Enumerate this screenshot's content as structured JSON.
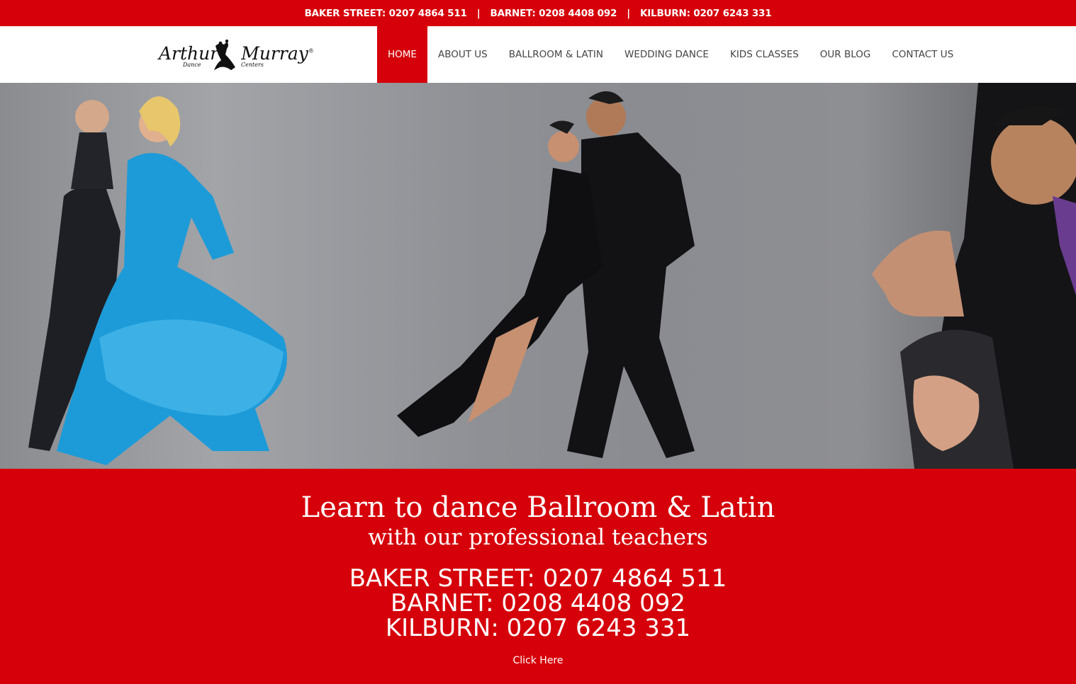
{
  "topbar": {
    "baker": "BAKER STREET: 0207 4864 511",
    "barnet": "BARNET: 0208 4408 092",
    "kilburn": "KILBURN: 0207 6243 331",
    "separator": "|"
  },
  "logo": {
    "left_word": "Arthur",
    "right_word": "Murray",
    "reg_mark": "®",
    "sub_left": "Dance",
    "sub_right": "Centers"
  },
  "nav": {
    "items": [
      {
        "label": "HOME",
        "active": true
      },
      {
        "label": "ABOUT US",
        "active": false
      },
      {
        "label": "BALLROOM & LATIN",
        "active": false
      },
      {
        "label": "WEDDING DANCE",
        "active": false
      },
      {
        "label": "KIDS CLASSES",
        "active": false
      },
      {
        "label": "OUR BLOG",
        "active": false
      },
      {
        "label": "CONTACT US",
        "active": false
      }
    ]
  },
  "promo": {
    "title": "Learn to dance Ballroom & Latin",
    "subtitle": "with our professional teachers",
    "phones": [
      "BAKER STREET: 0207 4864 511",
      "BARNET: 0208 4408 092",
      "KILBURN: 0207 6243 331"
    ],
    "link": "Click Here"
  },
  "colors": {
    "brand_red": "#d50009",
    "text_dark": "#444444",
    "hero_gray": "#8e9095"
  }
}
